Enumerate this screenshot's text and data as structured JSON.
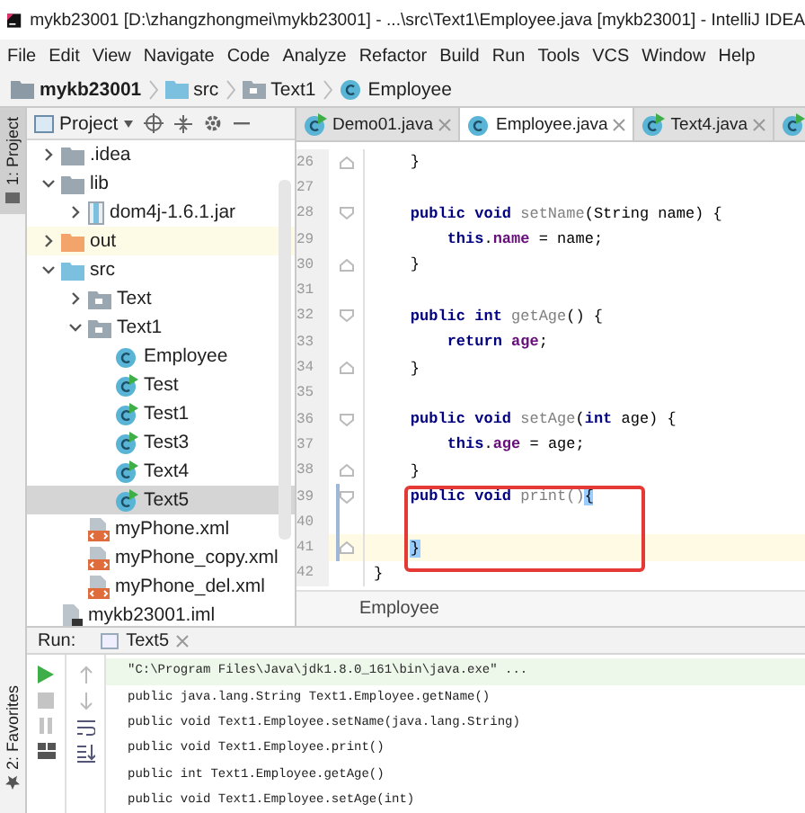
{
  "window": {
    "title": "mykb23001 [D:\\zhangzhongmei\\mykb23001] - ...\\src\\Text1\\Employee.java [mykb23001] - IntelliJ IDEA"
  },
  "menu": [
    "File",
    "Edit",
    "View",
    "Navigate",
    "Code",
    "Analyze",
    "Refactor",
    "Build",
    "Run",
    "Tools",
    "VCS",
    "Window",
    "Help"
  ],
  "breadcrumbs": [
    {
      "label": "mykb23001",
      "kind": "module"
    },
    {
      "label": "src",
      "kind": "source-folder"
    },
    {
      "label": "Text1",
      "kind": "package"
    },
    {
      "label": "Employee",
      "kind": "class"
    }
  ],
  "side_stripe": [
    {
      "label": "1: Project",
      "selected": true
    },
    {
      "label": "2: Favorites",
      "selected": false
    }
  ],
  "project_panel": {
    "title": "Project",
    "tree": [
      {
        "label": ".idea",
        "kind": "folder",
        "expanded": false,
        "selected": false
      },
      {
        "label": "lib",
        "kind": "folder",
        "expanded": true,
        "selected": false,
        "children": [
          {
            "label": "dom4j-1.6.1.jar",
            "kind": "jar",
            "expanded": false,
            "selected": false
          }
        ]
      },
      {
        "label": "out",
        "kind": "excluded-folder",
        "expanded": false,
        "selected": false
      },
      {
        "label": "src",
        "kind": "source-folder",
        "expanded": true,
        "selected": false,
        "children": [
          {
            "label": "Text",
            "kind": "package",
            "expanded": false,
            "selected": false
          },
          {
            "label": "Text1",
            "kind": "package",
            "expanded": true,
            "selected": false,
            "children": [
              {
                "label": "Employee",
                "kind": "class",
                "selected": false
              },
              {
                "label": "Test",
                "kind": "runnable-class",
                "selected": false
              },
              {
                "label": "Test1",
                "kind": "runnable-class",
                "selected": false
              },
              {
                "label": "Test3",
                "kind": "runnable-class",
                "selected": false
              },
              {
                "label": "Text4",
                "kind": "runnable-class",
                "selected": false
              },
              {
                "label": "Text5",
                "kind": "runnable-class",
                "selected": true
              }
            ]
          },
          {
            "label": "myPhone.xml",
            "kind": "xml",
            "selected": false
          },
          {
            "label": "myPhone_copy.xml",
            "kind": "xml",
            "selected": false
          },
          {
            "label": "myPhone_del.xml",
            "kind": "xml",
            "selected": false
          }
        ]
      },
      {
        "label": "mykb23001.iml",
        "kind": "iml",
        "selected": false
      }
    ]
  },
  "editor_tabs": [
    {
      "label": "Demo01.java",
      "kind": "runnable-class",
      "selected": false
    },
    {
      "label": "Employee.java",
      "kind": "class",
      "selected": true
    },
    {
      "label": "Text4.java",
      "kind": "runnable-class",
      "selected": false
    },
    {
      "kind": "runnable-class",
      "selected": false
    }
  ],
  "code_lines": [
    {
      "number": "26",
      "fold_end": true,
      "changed": false,
      "current": false,
      "tokens": [
        {
          "text": "    }",
          "kind": "plain"
        }
      ]
    },
    {
      "number": "27",
      "changed": false,
      "current": false
    },
    {
      "number": "28",
      "fold_start": true,
      "changed": false,
      "current": false,
      "tokens": [
        {
          "text": "    public void ",
          "kind": "keyword"
        },
        {
          "text": "setName",
          "kind": "unused"
        },
        {
          "text": "(String name) {",
          "kind": "plain"
        }
      ]
    },
    {
      "number": "29",
      "changed": false,
      "current": false,
      "tokens": [
        {
          "text": "        this",
          "kind": "keyword"
        },
        {
          "text": ".",
          "kind": "plain"
        },
        {
          "text": "name",
          "kind": "field"
        },
        {
          "text": " = name;",
          "kind": "plain"
        }
      ]
    },
    {
      "number": "30",
      "fold_end": true,
      "changed": false,
      "current": false,
      "tokens": [
        {
          "text": "    }",
          "kind": "plain"
        }
      ]
    },
    {
      "number": "31",
      "changed": false,
      "current": false
    },
    {
      "number": "32",
      "fold_start": true,
      "changed": false,
      "current": false,
      "tokens": [
        {
          "text": "    public int ",
          "kind": "keyword"
        },
        {
          "text": "getAge",
          "kind": "unused"
        },
        {
          "text": "() {",
          "kind": "plain"
        }
      ]
    },
    {
      "number": "33",
      "changed": false,
      "current": false,
      "tokens": [
        {
          "text": "        return ",
          "kind": "keyword"
        },
        {
          "text": "age",
          "kind": "field"
        },
        {
          "text": ";",
          "kind": "plain"
        }
      ]
    },
    {
      "number": "34",
      "fold_end": true,
      "changed": false,
      "current": false,
      "tokens": [
        {
          "text": "    }",
          "kind": "plain"
        }
      ]
    },
    {
      "number": "35",
      "changed": false,
      "current": false
    },
    {
      "number": "36",
      "fold_start": true,
      "changed": false,
      "current": false,
      "tokens": [
        {
          "text": "    public void ",
          "kind": "keyword"
        },
        {
          "text": "setAge",
          "kind": "unused"
        },
        {
          "text": "(",
          "kind": "plain"
        },
        {
          "text": "int ",
          "kind": "keyword"
        },
        {
          "text": "age) {",
          "kind": "plain"
        }
      ]
    },
    {
      "number": "37",
      "changed": false,
      "current": false,
      "tokens": [
        {
          "text": "        this",
          "kind": "keyword"
        },
        {
          "text": ".",
          "kind": "plain"
        },
        {
          "text": "age",
          "kind": "field"
        },
        {
          "text": " = age;",
          "kind": "plain"
        }
      ]
    },
    {
      "number": "38",
      "fold_end": true,
      "changed": false,
      "current": false,
      "tokens": [
        {
          "text": "    }",
          "kind": "plain"
        }
      ]
    },
    {
      "number": "39",
      "fold_start": true,
      "changed": true,
      "current": false,
      "tokens": [
        {
          "text": "    public void ",
          "kind": "keyword"
        },
        {
          "text": "print()",
          "kind": "unused"
        },
        {
          "text": "{",
          "kind": "matched-brace"
        }
      ]
    },
    {
      "number": "40",
      "changed": true,
      "current": false
    },
    {
      "number": "41",
      "fold_end": true,
      "changed": true,
      "current": true,
      "tokens": [
        {
          "text": "    }",
          "kind": "matched-brace"
        }
      ]
    },
    {
      "number": "42",
      "changed": false,
      "current": false,
      "tokens": [
        {
          "text": "}",
          "kind": "plain"
        }
      ]
    }
  ],
  "editor_breadcrumb": "Employee",
  "run_panel": {
    "label": "Run:",
    "tab": "Text5",
    "output": [
      {
        "text": "\"C:\\Program Files\\Java\\jdk1.8.0_161\\bin\\java.exe\" ...",
        "kind": "command"
      },
      {
        "text": "public java.lang.String Text1.Employee.getName()",
        "kind": "stdout"
      },
      {
        "text": "public void Text1.Employee.setName(java.lang.String)",
        "kind": "stdout"
      },
      {
        "text": "public void Text1.Employee.print()",
        "kind": "stdout"
      },
      {
        "text": "public int Text1.Employee.getAge()",
        "kind": "stdout"
      },
      {
        "text": "public void Text1.Employee.setAge(int)",
        "kind": "stdout"
      }
    ]
  }
}
